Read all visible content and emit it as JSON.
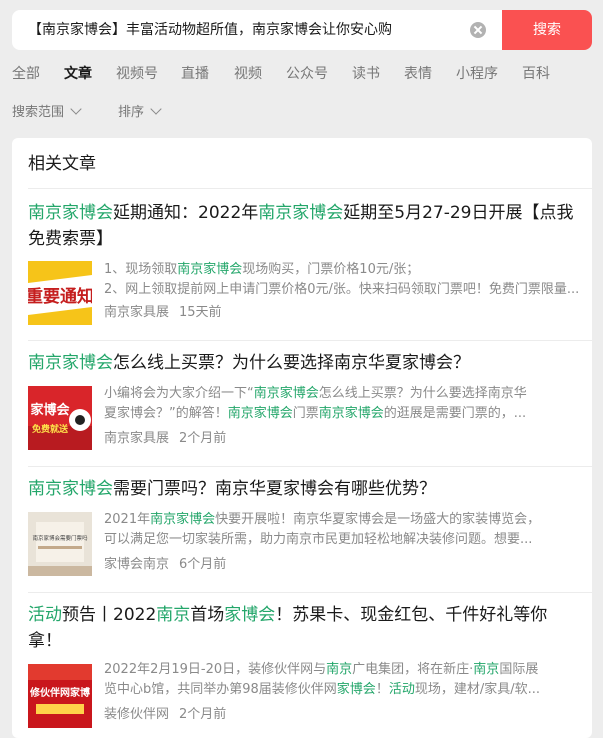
{
  "search": {
    "query": "【南京家博会】丰富活动物超所值，南京家博会让你安心购",
    "button": "搜索"
  },
  "tabs": [
    "全部",
    "文章",
    "视频号",
    "直播",
    "视频",
    "公众号",
    "读书",
    "表情",
    "小程序",
    "百科"
  ],
  "active_tab": "文章",
  "filters": {
    "scope": "搜索范围",
    "sort": "排序"
  },
  "section_title": "相关文章",
  "results": [
    {
      "title_parts": [
        {
          "t": "南京家博会",
          "hl": true
        },
        {
          "t": "延期通知：2022年",
          "hl": false
        },
        {
          "t": "南京家博会",
          "hl": true
        },
        {
          "t": "延期至5月27-29日开展【点我免费索票】",
          "hl": false
        }
      ],
      "thumb_text": "重要通知",
      "snippet_lines": [
        [
          {
            "t": "1、现场领取",
            "hl": false
          },
          {
            "t": "南京家博会",
            "hl": true
          },
          {
            "t": "现场购买，门票价格10元/张；",
            "hl": false
          }
        ],
        [
          {
            "t": "2、网上领取提前网上申请门票价格0元/张。快来扫码领取门票吧！免费门票限量...",
            "hl": false
          }
        ]
      ],
      "source": "南京家具展",
      "time": "15天前"
    },
    {
      "title_parts": [
        {
          "t": "南京家博会",
          "hl": true
        },
        {
          "t": "怎么线上买票？为什么要选择南京华夏家博会？",
          "hl": false
        }
      ],
      "thumb_text": "家博会",
      "thumb_sub": "免费就送",
      "snippet_lines": [
        [
          {
            "t": "小编将会为大家介绍一下“",
            "hl": false
          },
          {
            "t": "南京家博会",
            "hl": true
          },
          {
            "t": "怎么线上买票？为什么要选择南京华",
            "hl": false
          }
        ],
        [
          {
            "t": "夏家博会？”的解答！",
            "hl": false
          },
          {
            "t": "南京家博会",
            "hl": true
          },
          {
            "t": "门票",
            "hl": false
          },
          {
            "t": "南京家博会",
            "hl": true
          },
          {
            "t": "的逛展是需要门票的，...",
            "hl": false
          }
        ]
      ],
      "source": "南京家具展",
      "time": "2个月前"
    },
    {
      "title_parts": [
        {
          "t": "南京家博会",
          "hl": true
        },
        {
          "t": "需要门票吗？南京华夏家博会有哪些优势？",
          "hl": false
        }
      ],
      "thumb_text": "南京家博会需要门票吗",
      "snippet_lines": [
        [
          {
            "t": "2021年",
            "hl": false
          },
          {
            "t": "南京家博会",
            "hl": true
          },
          {
            "t": "快要开展啦！南京华夏家博会是一场盛大的家装博览会，",
            "hl": false
          }
        ],
        [
          {
            "t": "可以满足您一切家装所需，助力南京市民更加轻松地解决装修问题。想要...",
            "hl": false
          }
        ]
      ],
      "source": "家博会南京",
      "time": "6个月前"
    },
    {
      "title_parts": [
        {
          "t": "活动",
          "hl": true
        },
        {
          "t": "预告丨2022",
          "hl": false
        },
        {
          "t": "南京",
          "hl": true
        },
        {
          "t": "首场",
          "hl": false
        },
        {
          "t": "家博会",
          "hl": true
        },
        {
          "t": "！苏果卡、现金红包、千件好礼等你拿！",
          "hl": false
        }
      ],
      "thumb_text": "修伙伴网家博",
      "snippet_lines": [
        [
          {
            "t": "2022年2月19日-20日，装修伙伴网与",
            "hl": false
          },
          {
            "t": "南京",
            "hl": true
          },
          {
            "t": "广电集团，将在新庄·",
            "hl": false
          },
          {
            "t": "南京",
            "hl": true
          },
          {
            "t": "国际展",
            "hl": false
          }
        ],
        [
          {
            "t": "览中心b馆，共同举办第98届装修伙伴网",
            "hl": false
          },
          {
            "t": "家博会",
            "hl": true
          },
          {
            "t": "！",
            "hl": false
          },
          {
            "t": "活动",
            "hl": true
          },
          {
            "t": "现场，建材/家具/软...",
            "hl": false
          }
        ]
      ],
      "source": "装修伙伴网",
      "time": "2个月前"
    }
  ],
  "colors": {
    "accent": "#fa5151",
    "highlight": "#23a66a",
    "muted": "#8a8a8a"
  }
}
